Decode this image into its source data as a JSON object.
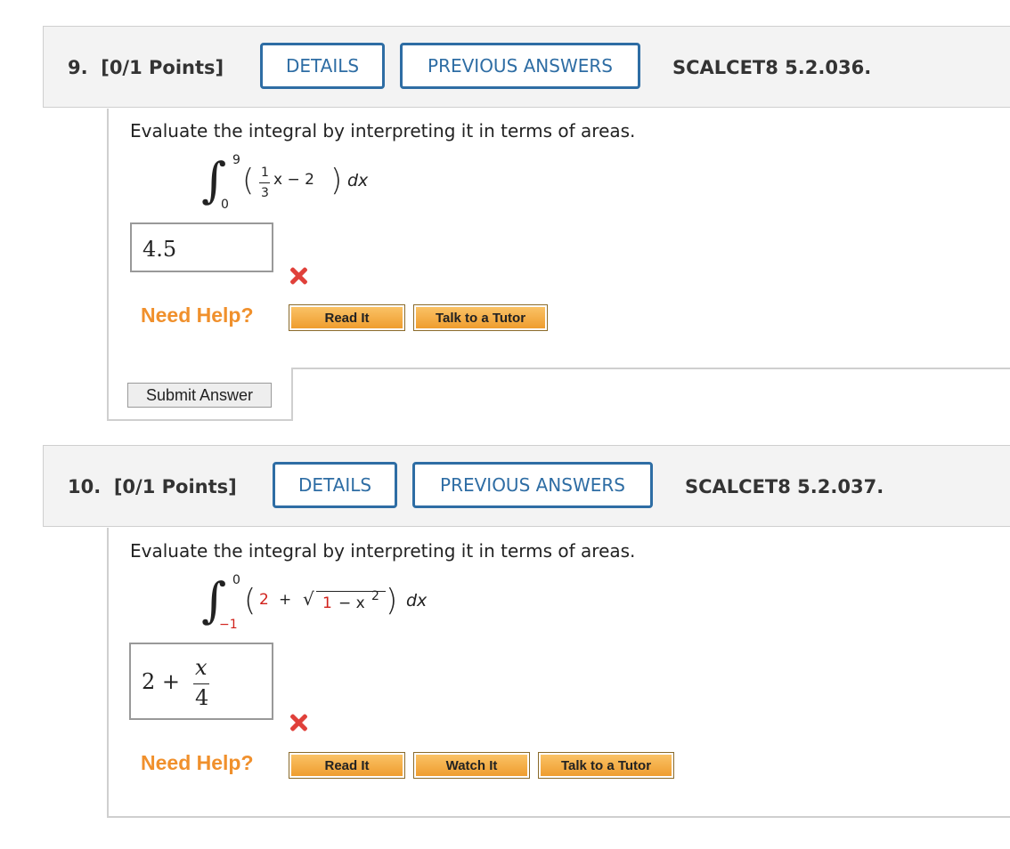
{
  "q9": {
    "number": "9.",
    "points": "[0/1 Points]",
    "details_label": "DETAILS",
    "previous_label": "PREVIOUS ANSWERS",
    "code": "SCALCET8 5.2.036.",
    "prompt": "Evaluate the integral by interpreting it in terms of areas.",
    "integral": {
      "upper": "9",
      "lower": "0",
      "frac_num": "1",
      "frac_den": "3",
      "after_frac": "x − 2",
      "dx": "dx"
    },
    "answer": "4.5",
    "need_help": "Need Help?",
    "help_buttons": [
      "Read It",
      "Talk to a Tutor"
    ],
    "submit_label": "Submit Answer"
  },
  "q10": {
    "number": "10.",
    "points": "[0/1 Points]",
    "details_label": "DETAILS",
    "previous_label": "PREVIOUS ANSWERS",
    "code": "SCALCET8 5.2.037.",
    "prompt": "Evaluate the integral by interpreting it in terms of areas.",
    "integral": {
      "upper": "0",
      "lower": "−1",
      "two": "2",
      "plus": "+",
      "sqrt_one": "1",
      "sqrt_rest": "− x",
      "sqrt_exp": "2",
      "dx": "dx"
    },
    "answer": {
      "lead": "2 +",
      "num": "x",
      "den": "4"
    },
    "need_help": "Need Help?",
    "help_buttons": [
      "Read It",
      "Watch It",
      "Talk to a Tutor"
    ]
  },
  "colors": {
    "accent_blue": "#2e6da4",
    "error_red": "#e0403a",
    "help_orange": "#f0902c"
  }
}
